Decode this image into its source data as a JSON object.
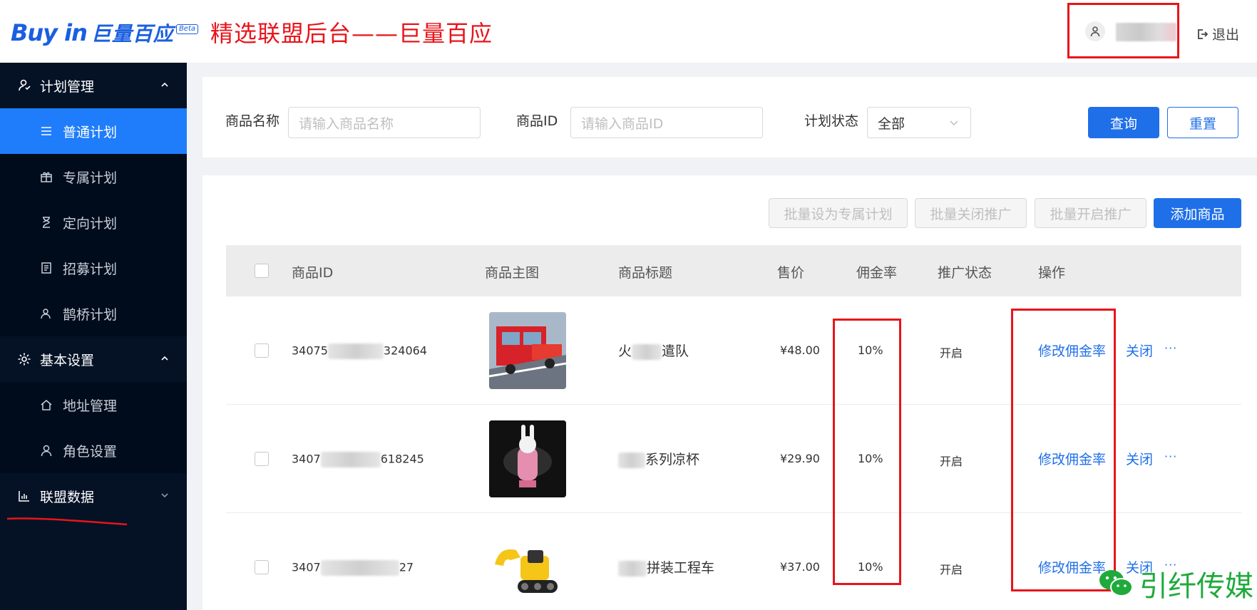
{
  "header": {
    "logo_text": "Buy in",
    "logo_cn": "巨量百应",
    "logo_badge": "Beta",
    "annotation_title": "精选联盟后台——巨量百应",
    "logout_label": "退出"
  },
  "sidebar": {
    "groups": [
      {
        "label": "计划管理",
        "icon": "plan-icon",
        "expanded": true
      },
      {
        "label": "基本设置",
        "icon": "gear-icon",
        "expanded": true
      },
      {
        "label": "联盟数据",
        "icon": "chart-icon",
        "expanded": false
      }
    ],
    "items": [
      {
        "label": "普通计划",
        "icon": "list-icon",
        "active": true
      },
      {
        "label": "专属计划",
        "icon": "gift-icon",
        "active": false
      },
      {
        "label": "定向计划",
        "icon": "hourglass-icon",
        "active": false
      },
      {
        "label": "招募计划",
        "icon": "recruit-icon",
        "active": false
      },
      {
        "label": "鹊桥计划",
        "icon": "bridge-icon",
        "active": false
      },
      {
        "label": "地址管理",
        "icon": "home-icon",
        "active": false
      },
      {
        "label": "角色设置",
        "icon": "user-icon",
        "active": false
      }
    ]
  },
  "filters": {
    "name_label": "商品名称",
    "name_placeholder": "请输入商品名称",
    "id_label": "商品ID",
    "id_placeholder": "请输入商品ID",
    "status_label": "计划状态",
    "status_value": "全部",
    "query_label": "查询",
    "reset_label": "重置"
  },
  "toolbar": {
    "batch_exclusive": "批量设为专属计划",
    "batch_close": "批量关闭推广",
    "batch_open": "批量开启推广",
    "add_product": "添加商品"
  },
  "table": {
    "columns": [
      "商品ID",
      "商品主图",
      "商品标题",
      "售价",
      "佣金率",
      "推广状态",
      "操作"
    ],
    "rows": [
      {
        "id_prefix": "34075",
        "id_suffix": "324064",
        "title_prefix": "火",
        "title_suffix": "遣队",
        "price": "¥48.00",
        "commission": "10%",
        "status": "开启",
        "action_edit": "修改佣金率",
        "action_close": "关闭",
        "action_more": "···",
        "image": "toy-fire-truck"
      },
      {
        "id_prefix": "3407",
        "id_suffix": "618245",
        "title_prefix": "",
        "title_suffix": "系列凉杯",
        "price": "¥29.90",
        "commission": "10%",
        "status": "开启",
        "action_edit": "修改佣金率",
        "action_close": "关闭",
        "action_more": "···",
        "image": "bunny-bottle"
      },
      {
        "id_prefix": "3407",
        "id_suffix": "27",
        "title_prefix": "",
        "title_suffix": "拼装工程车",
        "price": "¥37.00",
        "commission": "10%",
        "status": "开启",
        "action_edit": "修改佣金率",
        "action_close": "关闭",
        "action_more": "···",
        "image": "toy-excavator"
      }
    ]
  },
  "watermark": {
    "text": "引纤传媒"
  },
  "colors": {
    "primary": "#1f6fe8",
    "sidebar": "#051226",
    "active": "#1f7dfb",
    "annotation": "#e8141b"
  }
}
